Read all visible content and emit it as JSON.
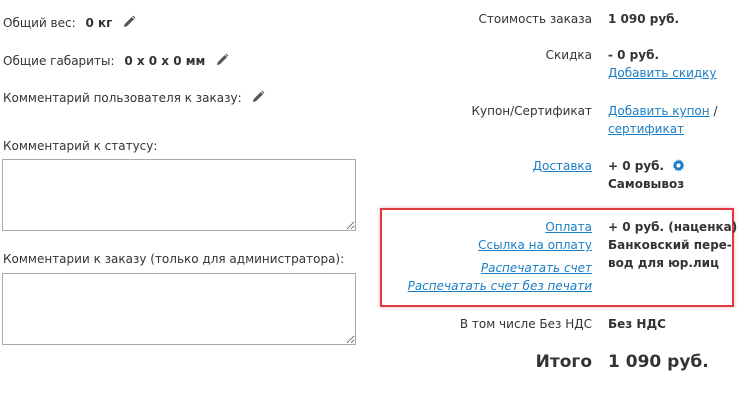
{
  "left": {
    "total_weight": {
      "label": "Общий вес:",
      "value": "0 кг"
    },
    "dimensions": {
      "label": "Общие габариты:",
      "value": "0 x 0 x 0 мм"
    },
    "user_comment": {
      "label": "Комментарий пользователя к заказу:"
    },
    "status_comment": {
      "label": "Комментарий к статусу:",
      "value": ""
    },
    "admin_comment": {
      "label": "Комментарии к заказу (только для администратора):",
      "value": ""
    }
  },
  "right": {
    "order_cost": {
      "label": "Стоимость заказа",
      "value": "1 090 руб."
    },
    "discount": {
      "label": "Скидка",
      "value": "- 0 руб.",
      "add_link": "Добавить скидку"
    },
    "coupon": {
      "label": "Купон/Сертификат",
      "add_link_line1": "Добавить купон",
      "slash": "/",
      "add_link_line2": "сертификат"
    },
    "delivery": {
      "label_link": "Доставка",
      "value": "+ 0 руб.",
      "method": "Самовывоз"
    },
    "payment": {
      "label_link": "Оплата",
      "value": "+ 0 руб. (наценка)",
      "method_line1": "Банковский пере-",
      "method_line2": "вод для юр.лиц",
      "pay_link": "Ссылка на оплату",
      "print_invoice": "Распечатать счет",
      "print_invoice_no_stamp": "Распечатать счет без печати"
    },
    "vat": {
      "label": "В том числе Без НДС",
      "value": "Без НДС"
    },
    "total": {
      "label": "Итого",
      "value": "1 090 руб."
    }
  },
  "colors": {
    "link": "#1a7ec4",
    "highlight": "#e03a3e",
    "text": "#333333"
  },
  "icons": {
    "edit": "pencil-icon",
    "settings": "gear-icon"
  }
}
